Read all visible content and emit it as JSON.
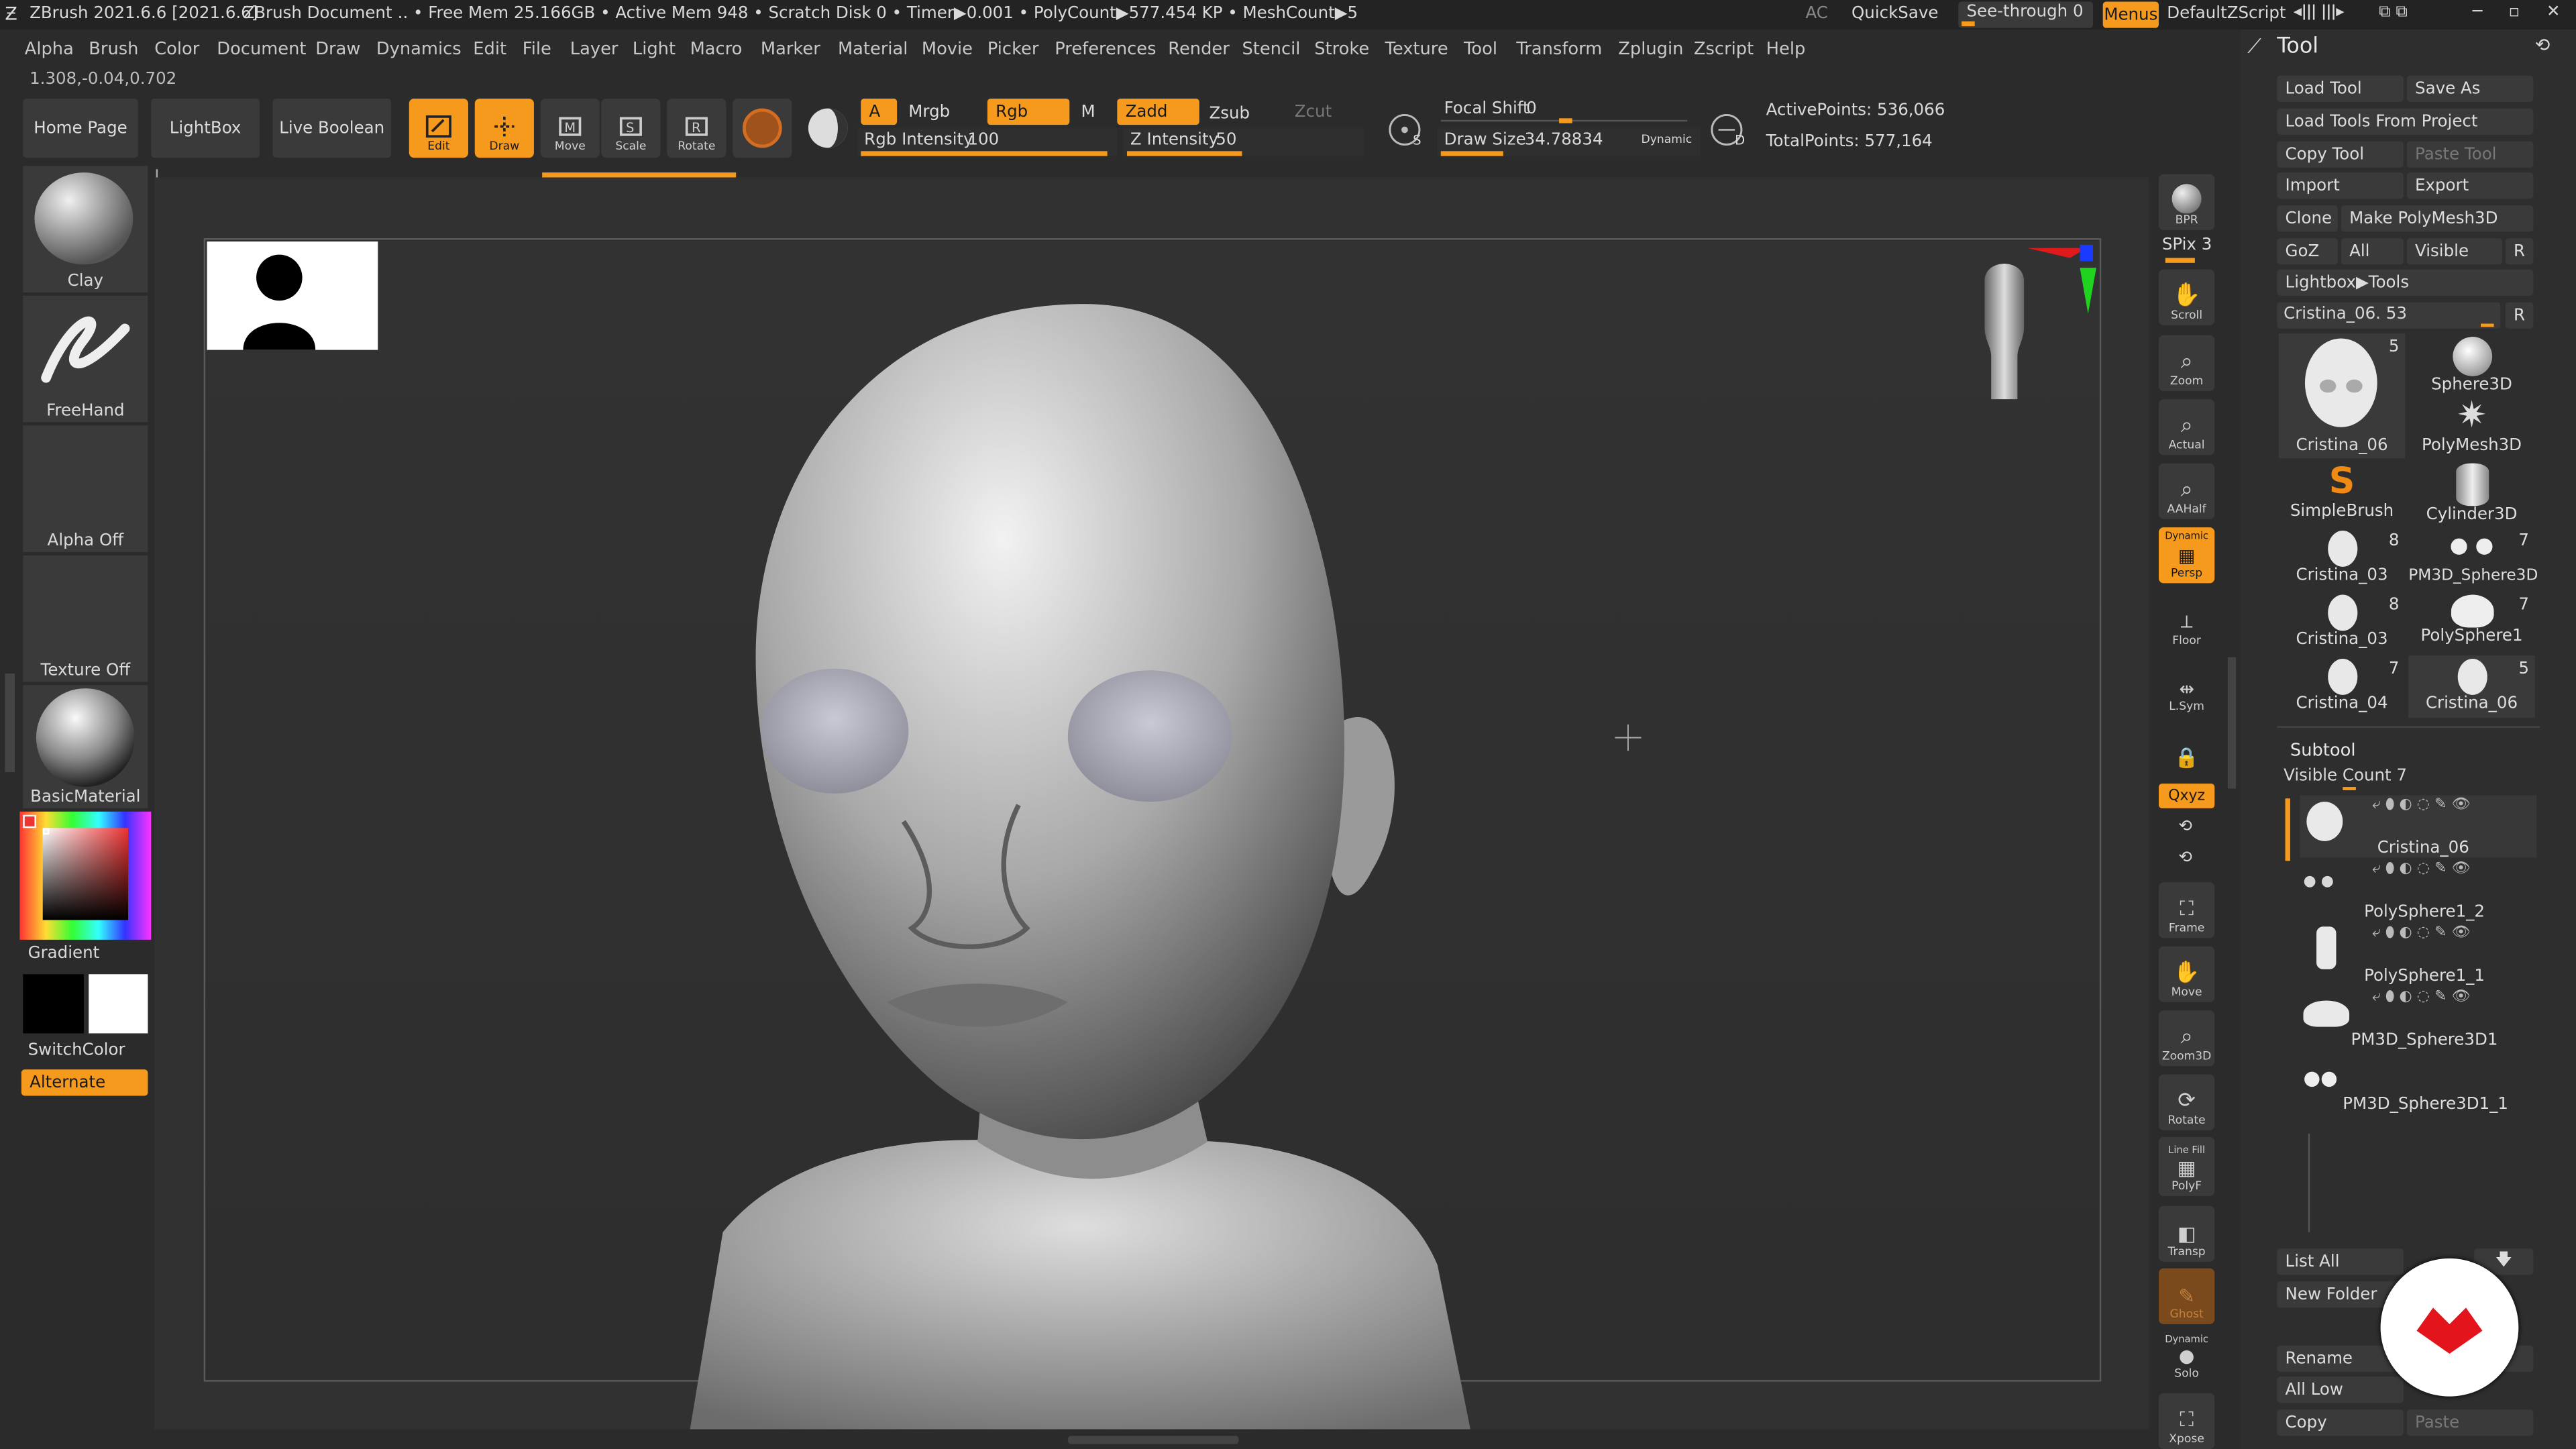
{
  "titlebar": {
    "app": "ZBrush 2021.6.6 [2021.6.6]",
    "document": "ZBrush Document",
    "stats": ".. • Free Mem 25.166GB • Active Mem 948 • Scratch Disk 0 • Timer▶0.001 • PolyCount▶577.454 KP  • MeshCount▶5",
    "ac": "AC",
    "quicksave": "QuickSave",
    "seethrough": "See-through  0",
    "menus": "Menus",
    "script": "DefaultZScript"
  },
  "menubar": [
    "Alpha",
    "Brush",
    "Color",
    "Document",
    "Draw",
    "Dynamics",
    "Edit",
    "File",
    "Layer",
    "Light",
    "Macro",
    "Marker",
    "Material",
    "Movie",
    "Picker",
    "Preferences",
    "Render",
    "Stencil",
    "Stroke",
    "Texture",
    "Tool",
    "Transform",
    "Zplugin",
    "Zscript",
    "Help"
  ],
  "coords": "1.308,-0.04,0.702",
  "toolbar": {
    "home": "Home Page",
    "lightbox": "LightBox",
    "liveboolean": "Live Boolean",
    "edit": "Edit",
    "draw": "Draw",
    "move": "Move",
    "scale": "Scale",
    "rotate": "Rotate",
    "a": "A",
    "mrgb": "Mrgb",
    "rgb": "Rgb",
    "m": "M",
    "zadd": "Zadd",
    "zsub": "Zsub",
    "zcut": "Zcut",
    "rgb_intensity_label": "Rgb Intensity",
    "rgb_intensity_value": "100",
    "rgb_intensity_fraction": 1.0,
    "z_intensity_label": "Z Intensity",
    "z_intensity_value": "50",
    "z_intensity_fraction": 0.5,
    "focal_label": "Focal Shift",
    "focal_value": "0",
    "drawsize_label": "Draw Size",
    "drawsize_value": "34.78834",
    "dynamic": "Dynamic",
    "s": "S",
    "d": "D",
    "active_points": "ActivePoints: 536,066",
    "total_points": "TotalPoints: 577,164"
  },
  "left_shelf": {
    "brush": "Clay",
    "stroke": "FreeHand",
    "alpha": "Alpha Off",
    "texture": "Texture Off",
    "material": "BasicMaterial",
    "gradient": "Gradient",
    "switchcolor": "SwitchColor",
    "alternate": "Alternate"
  },
  "right_shelf": {
    "bpr": "BPR",
    "spix": "SPix 3",
    "scroll": "Scroll",
    "zoom": "Zoom",
    "actual": "Actual",
    "aahalf": "AAHalf",
    "dynamic": "Dynamic",
    "persp": "Persp",
    "floor": "Floor",
    "lsym": "L.Sym",
    "xyz": "Qxyz",
    "frame": "Frame",
    "move": "Move",
    "zoom3d": "Zoom3D",
    "rotate": "Rotate",
    "linefill": "Line Fill",
    "polyf": "PolyF",
    "transp": "Transp",
    "ghost": "Ghost",
    "dynamic2": "Dynamic",
    "solo": "Solo",
    "xpose": "Xpose"
  },
  "tool_panel": {
    "title": "Tool",
    "load_tool": "Load Tool",
    "save_as": "Save As",
    "load_from_project": "Load Tools From Project",
    "copy_tool": "Copy Tool",
    "paste_tool": "Paste Tool",
    "import": "Import",
    "export": "Export",
    "clone": "Clone",
    "make_polymesh": "Make PolyMesh3D",
    "goz": "GoZ",
    "all": "All",
    "visible": "Visible",
    "r": "R",
    "lightbox_tools": "Lightbox▶Tools",
    "current_tool": "Cristina_06. 53",
    "r2": "R",
    "thumbnails": [
      {
        "name": "Cristina_06",
        "count": "5"
      },
      {
        "name": "Sphere3D",
        "count": ""
      },
      {
        "name": "PolyMesh3D",
        "count": ""
      },
      {
        "name": "SimpleBrush",
        "count": ""
      },
      {
        "name": "Cylinder3D",
        "count": ""
      },
      {
        "name": "Cristina_03",
        "count": "8"
      },
      {
        "name": "PM3D_Sphere3D",
        "count": "7"
      },
      {
        "name": "Cristina_03",
        "count": "8"
      },
      {
        "name": "PolySphere1",
        "count": "7"
      },
      {
        "name": "Cristina_04",
        "count": "7"
      },
      {
        "name": "Cristina_06",
        "count": "5"
      }
    ]
  },
  "subtool": {
    "title": "Subtool",
    "visible_count": "Visible Count 7",
    "items": [
      "Cristina_06",
      "PolySphere1_2",
      "PolySphere1_1",
      "PM3D_Sphere3D1",
      "PM3D_Sphere3D1_1"
    ],
    "list_all": "List All",
    "new_folder": "New Folder",
    "rename": "Rename",
    "all_low": "All Low",
    "copy": "Copy",
    "paste": "Paste"
  },
  "colors": {
    "accent": "#f59a1d",
    "panel": "#3a3a3a",
    "bg": "#2b2b2b"
  }
}
